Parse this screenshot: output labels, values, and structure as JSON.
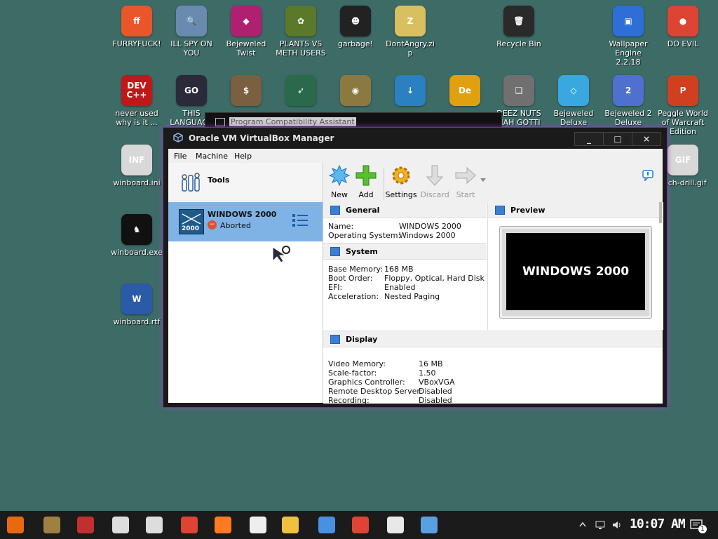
{
  "desktop_icons": [
    {
      "id": "furryfuck",
      "label": "FURRYFUCK!",
      "color": "#e8562a",
      "glyph": "ff"
    },
    {
      "id": "ill-spy",
      "label": "ILL SPY ON YOU",
      "color": "#6a8ab0",
      "glyph": "🔍"
    },
    {
      "id": "bejeweled-twist",
      "label": "Bejeweled Twist",
      "color": "#b02070",
      "glyph": "◆"
    },
    {
      "id": "plants-vs-meth",
      "label": "PLANTS VS METH USERS",
      "color": "#5a7a2a",
      "glyph": "✿"
    },
    {
      "id": "garbage",
      "label": "garbage!",
      "color": "#222222",
      "glyph": "☻"
    },
    {
      "id": "dontangry",
      "label": "DontAngry.zip",
      "color": "#d8c060",
      "glyph": "Z"
    },
    {
      "id": "recycle-bin",
      "label": "Recycle Bin",
      "color": "#2a2a2a",
      "glyph": "🗑"
    },
    {
      "id": "wallpaper-engine",
      "label": "Wallpaper Engine 2.2.18",
      "color": "#2d6fd6",
      "glyph": "▣"
    },
    {
      "id": "do-evil",
      "label": "DO EVIL",
      "color": "#dd4433",
      "glyph": "●"
    },
    {
      "id": "never-used",
      "label": "never used why is it ...",
      "color": "#c01818",
      "glyph": "DEV C++"
    },
    {
      "id": "this-language",
      "label": "THIS LANGUAGE",
      "color": "#2a2a3a",
      "glyph": "GO"
    },
    {
      "id": "money",
      "label": "",
      "color": "#7a6040",
      "glyph": "$"
    },
    {
      "id": "rocket",
      "label": "",
      "color": "#2a6a4a",
      "glyph": "➶"
    },
    {
      "id": "coin",
      "label": "",
      "color": "#8a7a40",
      "glyph": "◉"
    },
    {
      "id": "idm",
      "label": "",
      "color": "#2a80c0",
      "glyph": "↓"
    },
    {
      "id": "de",
      "label": "",
      "color": "#e0a010",
      "glyph": "De"
    },
    {
      "id": "deez-nuts",
      "label": "DEEZ NUTS HAH GOTTI",
      "color": "#707070",
      "glyph": "❏"
    },
    {
      "id": "bejeweled-deluxe",
      "label": "Bejeweled Deluxe",
      "color": "#3aa8e0",
      "glyph": "◇"
    },
    {
      "id": "bejeweled2-deluxe",
      "label": "Bejeweled 2 Deluxe",
      "color": "#5070d0",
      "glyph": "2"
    },
    {
      "id": "peggle",
      "label": "Peggle World of Warcraft Edition",
      "color": "#d04020",
      "glyph": "P"
    },
    {
      "id": "winboard-ini",
      "label": "winboard.ini",
      "color": "#d8d8d8",
      "glyph": "INF"
    },
    {
      "id": "winboard-exe",
      "label": "winboard.exe",
      "color": "#111111",
      "glyph": "♞"
    },
    {
      "id": "winboard-rtf",
      "label": "winboard.rtf",
      "color": "#2a5aa8",
      "glyph": "W"
    },
    {
      "id": "gif-file",
      "label": "osch-drill.gif",
      "color": "#d8d8d8",
      "glyph": "GIF"
    }
  ],
  "compat_dialog": {
    "title": "Program Compatibility Assistant"
  },
  "window": {
    "title": "Oracle VM VirtualBox Manager",
    "controls": {
      "minimize": "_",
      "maximize": "□",
      "close": "×"
    },
    "menu": [
      "File",
      "Machine",
      "Help"
    ],
    "tools_label": "Tools",
    "vm": {
      "name": "WINDOWS 2000",
      "state": "Aborted",
      "logo_text": "2000"
    },
    "toolbar": {
      "new": "New",
      "add": "Add",
      "settings": "Settings",
      "discard": "Discard",
      "start": "Start"
    },
    "general": {
      "header": "General",
      "name_label": "Name:",
      "name_value": "WINDOWS 2000",
      "os_label": "Operating System:",
      "os_value": "Windows 2000"
    },
    "system": {
      "header": "System",
      "base_memory_label": "Base Memory:",
      "base_memory_value": "168 MB",
      "boot_order_label": "Boot Order:",
      "boot_order_value": "Floppy, Optical, Hard Disk",
      "efi_label": "EFI:",
      "efi_value": "Enabled",
      "accel_label": "Acceleration:",
      "accel_value": "Nested Paging"
    },
    "preview": {
      "header": "Preview",
      "screen_text": "WINDOWS 2000"
    },
    "display": {
      "header": "Display",
      "video_memory_label": "Video Memory:",
      "video_memory_value": "16 MB",
      "scale_label": "Scale-factor:",
      "scale_value": "1.50",
      "graphics_label": "Graphics Controller:",
      "graphics_value": "VBoxVGA",
      "rds_label": "Remote Desktop Server:",
      "rds_value": "Disabled",
      "recording_label": "Recording:",
      "recording_value": "Disabled"
    }
  },
  "taskbar": {
    "clock": "10:07 AM",
    "notification_count": "1",
    "apps": [
      "start",
      "app1",
      "app2",
      "app3",
      "app4",
      "chrome",
      "firefox",
      "7zip",
      "explorer",
      "qbittorrent",
      "chrome2",
      "tasklist",
      "virtualbox"
    ]
  }
}
